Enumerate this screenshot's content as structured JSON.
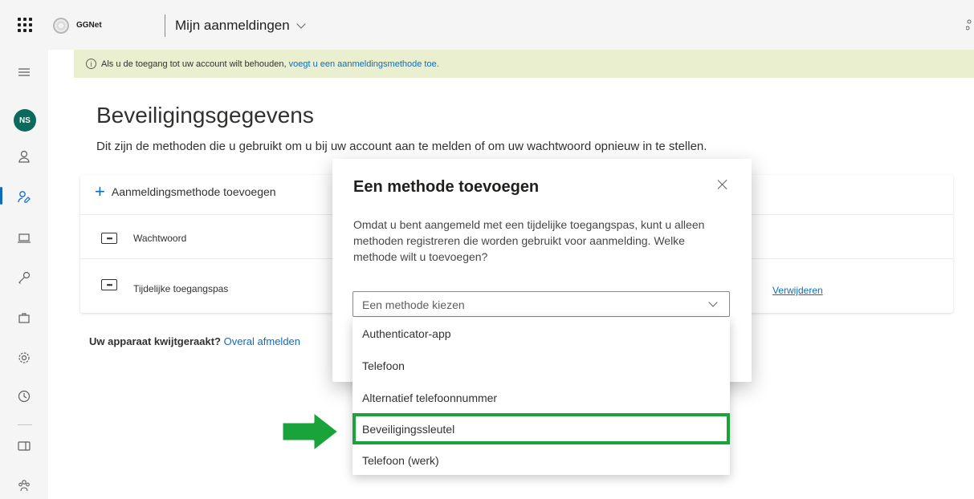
{
  "header": {
    "org_name": "GGNet",
    "app_title": "Mijn aanmeldingen"
  },
  "rail": {
    "avatar_initials": "NS"
  },
  "banner": {
    "text": "Als u de toegang tot uw account wilt behouden, ",
    "link": "voegt u een aanmeldingsmethode toe."
  },
  "page": {
    "title": "Beveiligingsgegevens",
    "subtitle": "Dit zijn de methoden die u gebruikt om u bij uw account aan te melden of om uw wachtwoord opnieuw in te stellen.",
    "add_method": "Aanmeldingsmethode toevoegen",
    "methods": [
      {
        "label": "Wachtwoord"
      },
      {
        "label": "Tijdelijke toegangspas",
        "action": "Verwijderen"
      }
    ],
    "lost_device_text": "Uw apparaat kwijtgeraakt?",
    "lost_device_link": "Overal afmelden"
  },
  "dialog": {
    "title": "Een methode toevoegen",
    "body": "Omdat u bent aangemeld met een tijdelijke toegangspas, kunt u alleen methoden registreren die worden gebruikt voor aanmelding. Welke methode wilt u toevoegen?",
    "select_placeholder": "Een methode kiezen",
    "options": [
      "Authenticator-app",
      "Telefoon",
      "Alternatief telefoonnummer",
      "Beveiligingssleutel",
      "Telefoon (werk)"
    ],
    "highlighted_option": "Beveiligingssleutel"
  },
  "colors": {
    "accent": "#0f6cbd",
    "highlight": "#1aa33a",
    "banner_bg": "#eaf0cf",
    "avatar_bg": "#0b6a5c"
  }
}
